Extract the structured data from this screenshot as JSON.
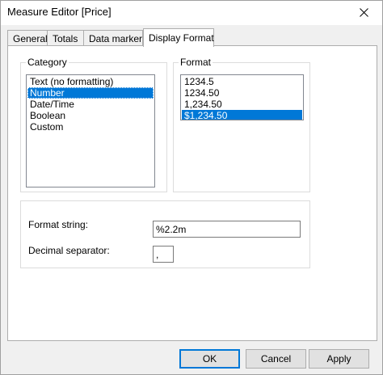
{
  "window": {
    "title": "Measure Editor [Price]"
  },
  "tabs": [
    {
      "label": "General"
    },
    {
      "label": "Totals"
    },
    {
      "label": "Data marker"
    },
    {
      "label": "Display Format"
    }
  ],
  "selected_tab": "Display Format",
  "category": {
    "label": "Category",
    "items": [
      "Text (no formatting)",
      "Number",
      "Date/Time",
      "Boolean",
      "Custom"
    ],
    "selected": "Number"
  },
  "format": {
    "label": "Format",
    "items": [
      "1234.5",
      "1234.50",
      "1,234.50",
      "$1,234.50"
    ],
    "selected": "$1,234.50"
  },
  "format_string": {
    "label": "Format string:",
    "value": "%2.2m"
  },
  "decimal_separator": {
    "label": "Decimal separator:",
    "value": ","
  },
  "buttons": {
    "ok": "OK",
    "cancel": "Cancel",
    "apply": "Apply"
  },
  "colors": {
    "selection": "#0078d7",
    "default_button_border": "#0078d7"
  }
}
